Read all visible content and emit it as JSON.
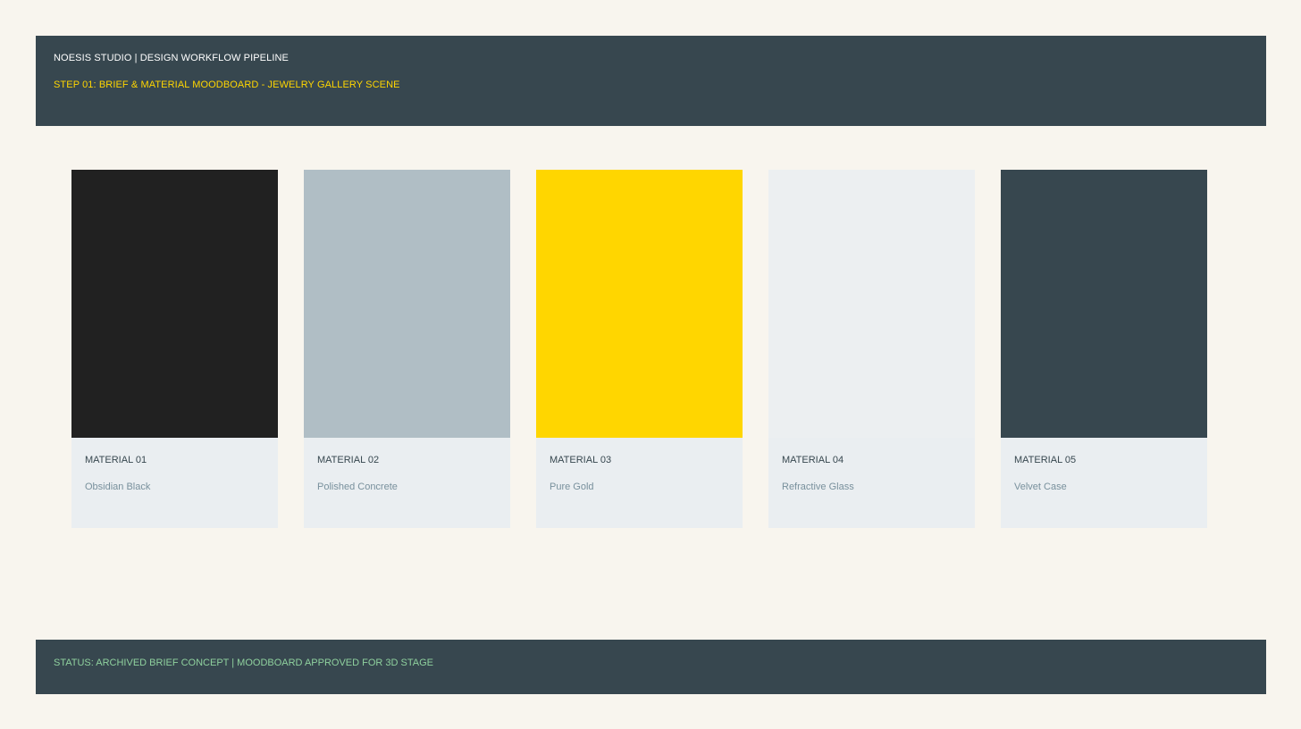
{
  "header": {
    "title": "NOESIS STUDIO | DESIGN WORKFLOW PIPELINE",
    "step": "STEP 01: BRIEF & MATERIAL MOODBOARD - JEWELRY GALLERY SCENE"
  },
  "materials": [
    {
      "label": "MATERIAL 01",
      "name": "Obsidian Black",
      "color": "#212121"
    },
    {
      "label": "MATERIAL 02",
      "name": "Polished Concrete",
      "color": "#b0bec5"
    },
    {
      "label": "MATERIAL 03",
      "name": "Pure Gold",
      "color": "#ffd600"
    },
    {
      "label": "MATERIAL 04",
      "name": "Refractive Glass",
      "color": "#eceff1"
    },
    {
      "label": "MATERIAL 05",
      "name": "Velvet Case",
      "color": "#37474f"
    }
  ],
  "footer": {
    "status": "STATUS: ARCHIVED BRIEF CONCEPT | MOODBOARD APPROVED FOR 3D STAGE"
  }
}
